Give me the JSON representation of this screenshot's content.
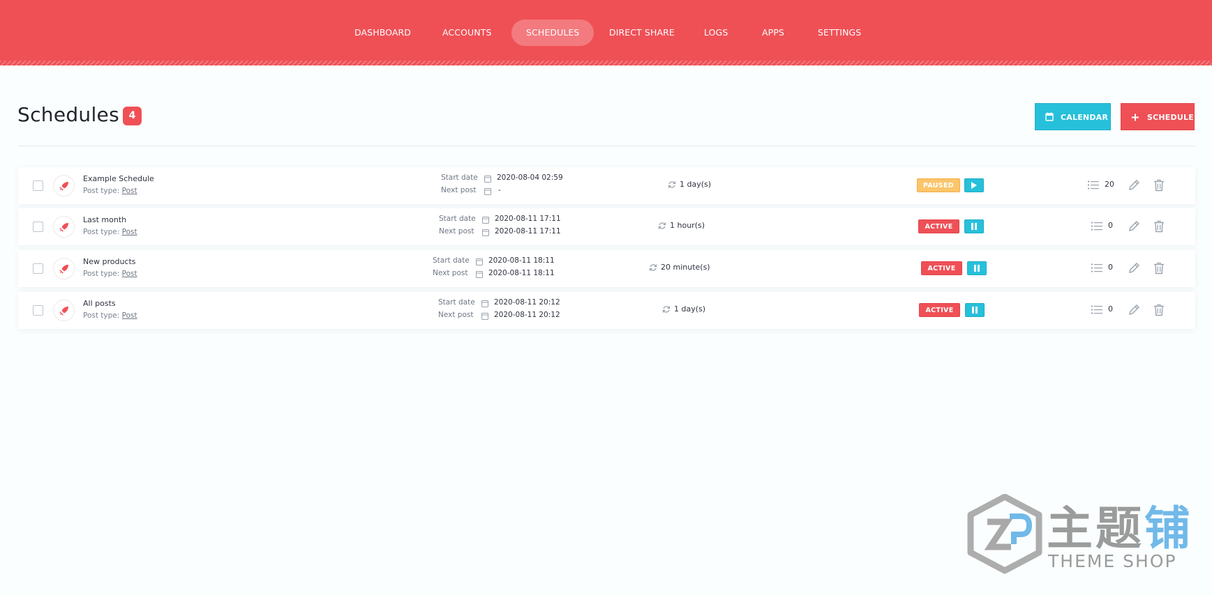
{
  "nav": {
    "items": [
      {
        "label": "DASHBOARD"
      },
      {
        "label": "ACCOUNTS"
      },
      {
        "label": "SCHEDULES",
        "active": true
      },
      {
        "label": "DIRECT SHARE"
      },
      {
        "label": "LOGS"
      },
      {
        "label": "APPS"
      },
      {
        "label": "SETTINGS"
      }
    ]
  },
  "page": {
    "title": "Schedules",
    "count": "4",
    "calendar_label": "CALENDAR",
    "schedule_label": "SCHEDULE"
  },
  "labels": {
    "start_date": "Start date",
    "next_post": "Next post",
    "post_type": "Post type:"
  },
  "rows": [
    {
      "name": "Example Schedule",
      "post_type": "Post",
      "start_date": "2020-08-04 02:59",
      "next_post": "-",
      "interval": "1 day(s)",
      "status": "PAUSED",
      "posts": "20"
    },
    {
      "name": "Last month",
      "post_type": "Post",
      "start_date": "2020-08-11 17:11",
      "next_post": "2020-08-11 17:11",
      "interval": "1 hour(s)",
      "status": "ACTIVE",
      "posts": "0"
    },
    {
      "name": "New products",
      "post_type": "Post",
      "start_date": "2020-08-11 18:11",
      "next_post": "2020-08-11 18:11",
      "interval": "20 minute(s)",
      "status": "ACTIVE",
      "posts": "0"
    },
    {
      "name": "All posts",
      "post_type": "Post",
      "start_date": "2020-08-11 20:12",
      "next_post": "2020-08-11 20:12",
      "interval": "1 day(s)",
      "status": "ACTIVE",
      "posts": "0"
    }
  ],
  "watermark": {
    "chinese_prefix": "主题",
    "chinese_suffix": "铺",
    "english": "THEME SHOP"
  },
  "colors": {
    "brand": "#ef5056",
    "accent": "#27c0da",
    "paused": "#fbc56b"
  },
  "icons": [
    "rocket-icon",
    "calendar-icon",
    "refresh-icon",
    "play-icon",
    "pause-icon",
    "list-icon",
    "pencil-icon",
    "trash-icon",
    "plus-icon"
  ]
}
